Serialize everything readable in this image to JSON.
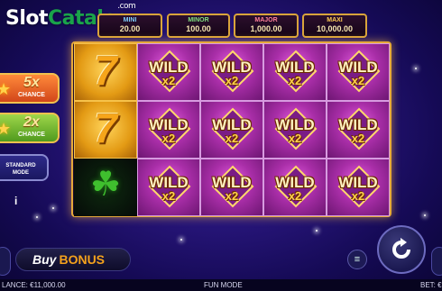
{
  "watermark": {
    "part1": "Slot",
    "part2": "Catalog",
    "suffix": ".com"
  },
  "jackpots": [
    {
      "label": "MINI",
      "value": "20.00",
      "color": "#7fd0ff"
    },
    {
      "label": "MINOR",
      "value": "100.00",
      "color": "#7fe07f"
    },
    {
      "label": "MAJOR",
      "value": "1,000.00",
      "color": "#ff7f9a"
    },
    {
      "label": "MAXI",
      "value": "10,000.00",
      "color": "#ffcc55"
    }
  ],
  "multipliers": [
    {
      "value": "5x",
      "label": "CHANCE"
    },
    {
      "value": "2x",
      "label": "CHANCE"
    }
  ],
  "mode_button": {
    "line1": "STANDARD",
    "line2": "MODE"
  },
  "info_icon": "i",
  "reels": [
    [
      "seven",
      "seven",
      "clover"
    ],
    [
      "wild",
      "wild",
      "wild"
    ],
    [
      "wild",
      "wild",
      "wild"
    ],
    [
      "wild",
      "wild",
      "wild"
    ],
    [
      "wild",
      "wild",
      "wild"
    ]
  ],
  "symbols": {
    "seven": "7",
    "clover": "☘",
    "wild_text": "WILD",
    "wild_mult": "x2"
  },
  "buy_bonus": {
    "word1": "Buy",
    "word2": "BONUS"
  },
  "bottom_bar": {
    "balance": "LANCE: €11,000.00",
    "mode": "FUN MODE",
    "bet": "BET: €"
  },
  "colors": {
    "frame": "#e6a93a",
    "wild_bg": "#a92ea8",
    "accent": "#f4a21c"
  }
}
